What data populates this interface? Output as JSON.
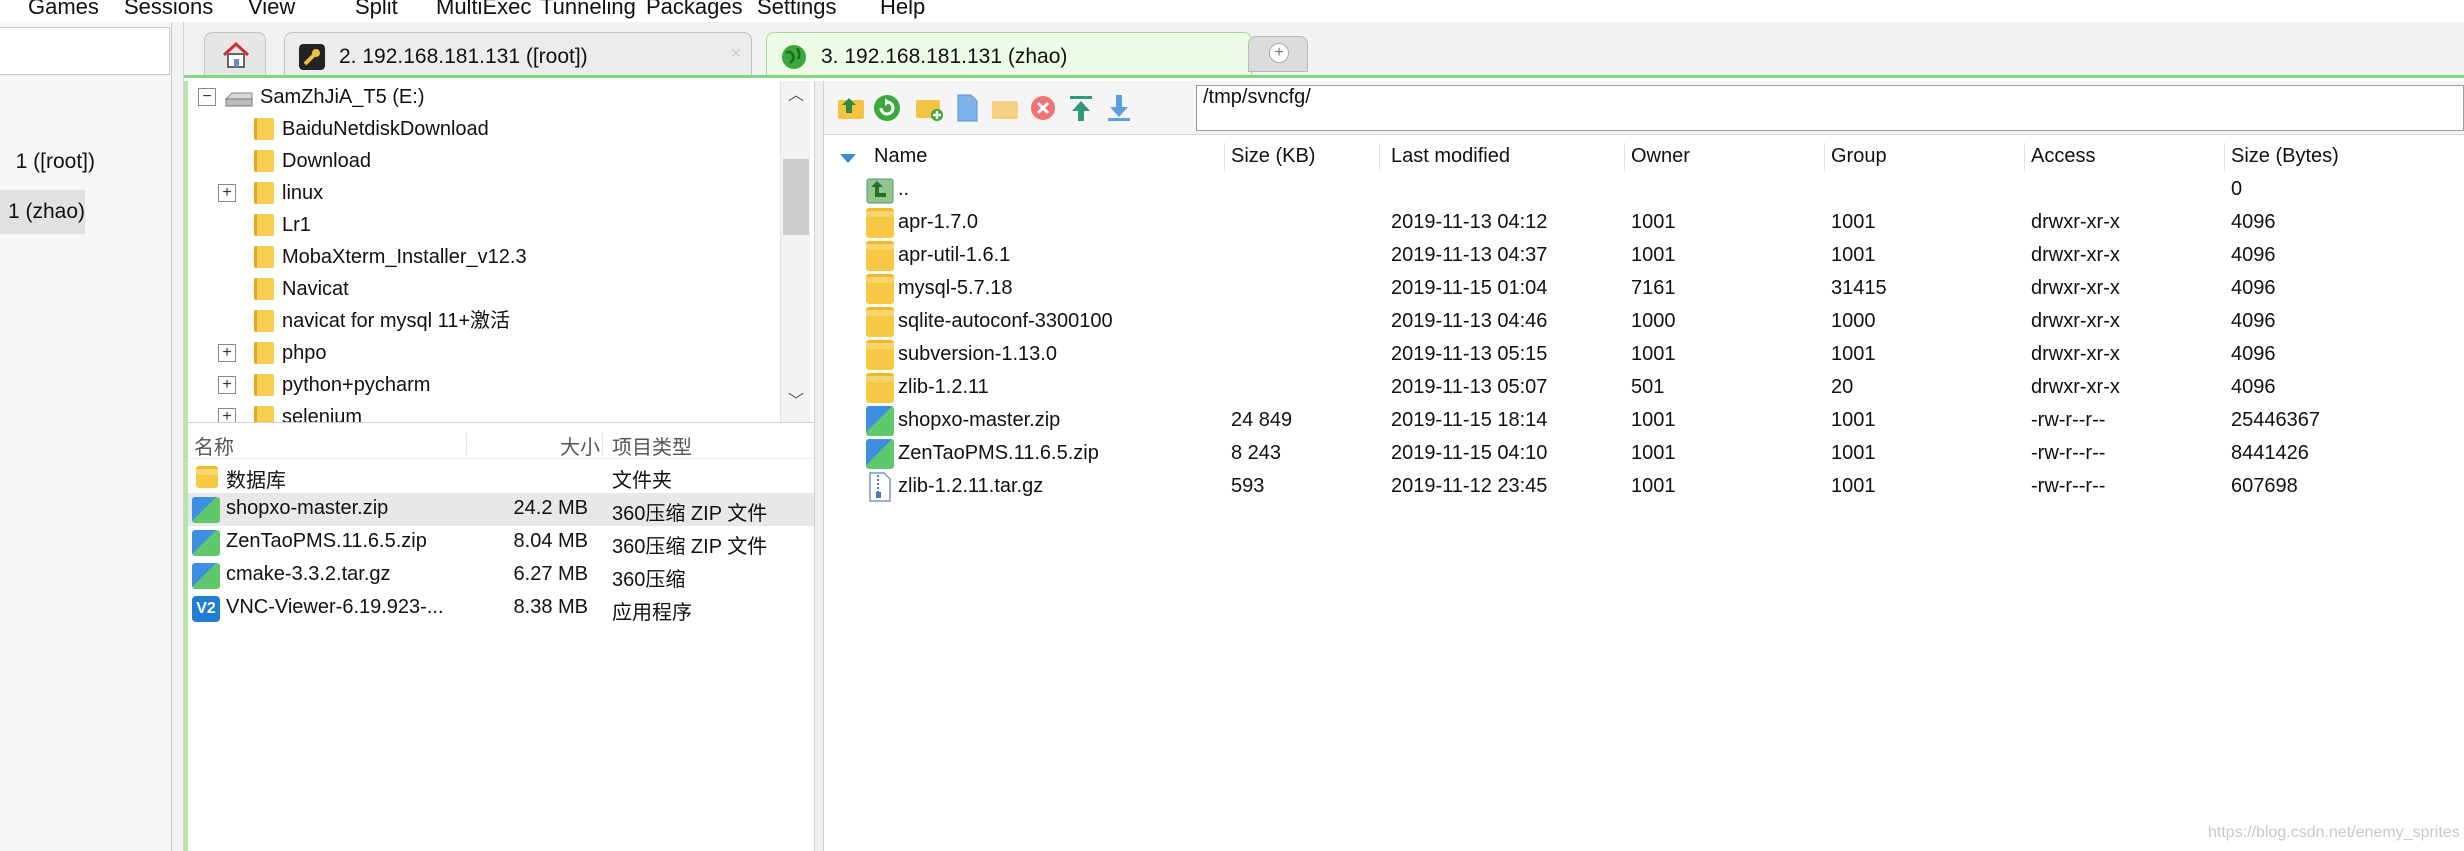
{
  "menu": [
    "Games",
    "Sessions",
    "View",
    "Split",
    "MultiExec",
    "Tunneling",
    "Packages",
    "Settings",
    "Help"
  ],
  "sessions": [
    {
      "label": "1 ([root])"
    },
    {
      "label": "1 (zhao)"
    }
  ],
  "tabs": [
    {
      "label": "2. 192.168.181.131 ([root])"
    },
    {
      "label": "3. 192.168.181.131 (zhao)"
    }
  ],
  "tree": {
    "root": "SamZhJiA_T5 (E:)",
    "items": [
      {
        "label": "BaiduNetdiskDownload",
        "expandable": false
      },
      {
        "label": "Download",
        "expandable": false
      },
      {
        "label": "linux",
        "expandable": true
      },
      {
        "label": "Lr1",
        "expandable": false
      },
      {
        "label": "MobaXterm_Installer_v12.3",
        "expandable": false
      },
      {
        "label": "Navicat",
        "expandable": false
      },
      {
        "label": "navicat for mysql 11+激活",
        "expandable": false
      },
      {
        "label": "phpo",
        "expandable": true
      },
      {
        "label": "python+pycharm",
        "expandable": true
      },
      {
        "label": "selenium",
        "expandable": true
      }
    ]
  },
  "local_list": {
    "headers": {
      "name": "名称",
      "size": "大小",
      "type": "项目类型"
    },
    "rows": [
      {
        "name": "数据库",
        "size": "",
        "type": "文件夹",
        "icon": "folder-icon"
      },
      {
        "name": "shopxo-master.zip",
        "size": "24.2 MB",
        "type": "360压缩 ZIP 文件",
        "icon": "zip-icon"
      },
      {
        "name": "ZenTaoPMS.11.6.5.zip",
        "size": "8.04 MB",
        "type": "360压缩 ZIP 文件",
        "icon": "zip-icon"
      },
      {
        "name": "cmake-3.3.2.tar.gz",
        "size": "6.27 MB",
        "type": "360压缩",
        "icon": "zip-icon"
      },
      {
        "name": "VNC-Viewer-6.19.923-...",
        "size": "8.38 MB",
        "type": "应用程序",
        "icon": "vnc-icon"
      }
    ]
  },
  "remote": {
    "path": "/tmp/svncfg/",
    "headers": {
      "name": "Name",
      "size_kb": "Size (KB)",
      "modified": "Last modified",
      "owner": "Owner",
      "group": "Group",
      "access": "Access",
      "size_bytes": "Size (Bytes)"
    },
    "rows": [
      {
        "name": "..",
        "size_kb": "",
        "modified": "",
        "owner": "",
        "group": "",
        "access": "",
        "size_bytes": "0",
        "icon": "parent-dir-icon"
      },
      {
        "name": "apr-1.7.0",
        "size_kb": "",
        "modified": "2019-11-13 04:12",
        "owner": "1001",
        "group": "1001",
        "access": "drwxr-xr-x",
        "size_bytes": "4096",
        "icon": "folder-icon"
      },
      {
        "name": "apr-util-1.6.1",
        "size_kb": "",
        "modified": "2019-11-13 04:37",
        "owner": "1001",
        "group": "1001",
        "access": "drwxr-xr-x",
        "size_bytes": "4096",
        "icon": "folder-icon"
      },
      {
        "name": "mysql-5.7.18",
        "size_kb": "",
        "modified": "2019-11-15 01:04",
        "owner": "7161",
        "group": "31415",
        "access": "drwxr-xr-x",
        "size_bytes": "4096",
        "icon": "folder-icon"
      },
      {
        "name": "sqlite-autoconf-3300100",
        "size_kb": "",
        "modified": "2019-11-13 04:46",
        "owner": "1000",
        "group": "1000",
        "access": "drwxr-xr-x",
        "size_bytes": "4096",
        "icon": "folder-icon"
      },
      {
        "name": "subversion-1.13.0",
        "size_kb": "",
        "modified": "2019-11-13 05:15",
        "owner": "1001",
        "group": "1001",
        "access": "drwxr-xr-x",
        "size_bytes": "4096",
        "icon": "folder-icon"
      },
      {
        "name": "zlib-1.2.11",
        "size_kb": "",
        "modified": "2019-11-13 05:07",
        "owner": "501",
        "group": "20",
        "access": "drwxr-xr-x",
        "size_bytes": "4096",
        "icon": "folder-icon"
      },
      {
        "name": "shopxo-master.zip",
        "size_kb": "24 849",
        "modified": "2019-11-15 18:14",
        "owner": "1001",
        "group": "1001",
        "access": "-rw-r--r--",
        "size_bytes": "25446367",
        "icon": "zip-icon"
      },
      {
        "name": "ZenTaoPMS.11.6.5.zip",
        "size_kb": "8 243",
        "modified": "2019-11-15 04:10",
        "owner": "1001",
        "group": "1001",
        "access": "-rw-r--r--",
        "size_bytes": "8441426",
        "icon": "zip-icon"
      },
      {
        "name": "zlib-1.2.11.tar.gz",
        "size_kb": "593",
        "modified": "2019-11-12 23:45",
        "owner": "1001",
        "group": "1001",
        "access": "-rw-r--r--",
        "size_bytes": "607698",
        "icon": "archive-icon"
      }
    ]
  },
  "watermark": "https://blog.csdn.net/enemy_sprites",
  "colors": {
    "accent_green": "#7fd67f",
    "sort_arrow": "#3a86e0",
    "folder": "#f7c843"
  }
}
